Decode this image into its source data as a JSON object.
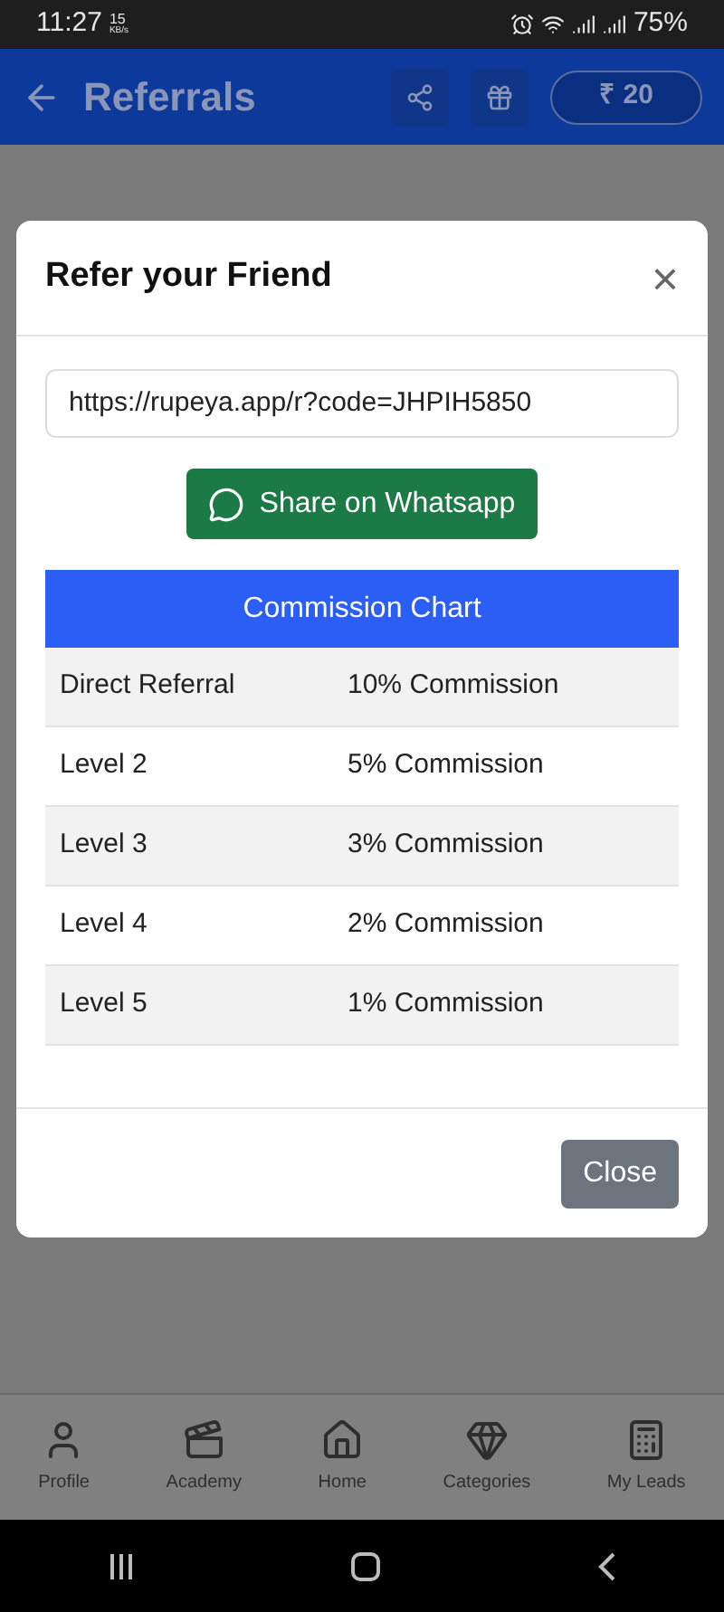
{
  "status_bar": {
    "time": "11:27",
    "speed_value": "15",
    "speed_unit": "KB/s",
    "battery": "75%"
  },
  "header": {
    "title": "Referrals",
    "balance": "₹ 20"
  },
  "dialog": {
    "title": "Refer your Friend",
    "close_symbol": "×",
    "link": "https://rupeya.app/r?code=JHPIH5850",
    "share_button": "Share on Whatsapp",
    "chart_title": "Commission Chart",
    "rows": [
      {
        "level": "Direct Referral",
        "commission": "10% Commission"
      },
      {
        "level": "Level 2",
        "commission": "5% Commission"
      },
      {
        "level": "Level 3",
        "commission": "3% Commission"
      },
      {
        "level": "Level 4",
        "commission": "2% Commission"
      },
      {
        "level": "Level 5",
        "commission": "1% Commission"
      }
    ],
    "close_button": "Close"
  },
  "bottom_nav": [
    {
      "kind": "profile",
      "label": "Profile"
    },
    {
      "kind": "academy",
      "label": "Academy"
    },
    {
      "kind": "home",
      "label": "Home"
    },
    {
      "kind": "categories",
      "label": "Categories"
    },
    {
      "kind": "leads",
      "label": "My Leads"
    }
  ]
}
